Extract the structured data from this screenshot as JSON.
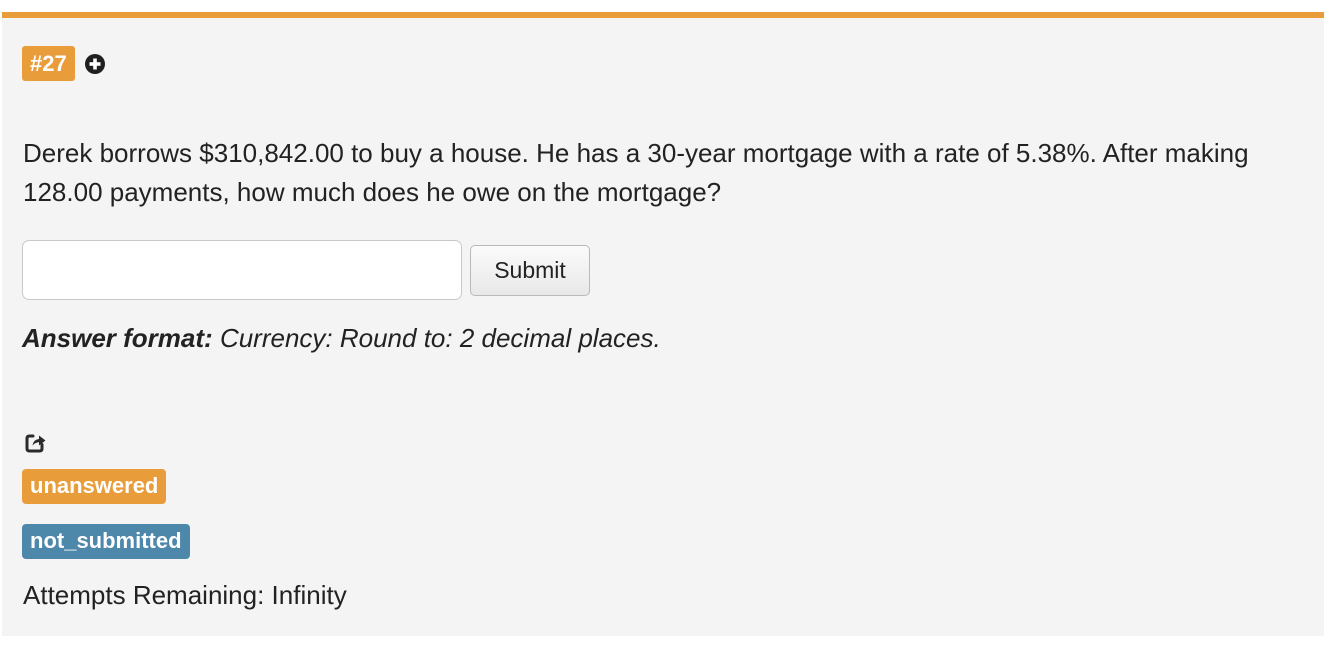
{
  "problem": {
    "number_label": "#27",
    "question_text": "Derek borrows $310,842.00 to buy a house. He has a 30-year mortgage with a rate of 5.38%. After making 128.00 payments, how much does he owe on the mortgage?",
    "answer_value": "",
    "submit_label": "Submit",
    "format_label": "Answer format:",
    "format_text": "Currency: Round to: 2 decimal places.",
    "status_badges": [
      "unanswered",
      "not_submitted"
    ],
    "attempts_text": "Attempts Remaining: Infinity"
  },
  "icons": {
    "add": "plus-circle-icon",
    "share": "share-icon"
  },
  "colors": {
    "accent": "#e99d3a",
    "info": "#4d87aa",
    "panel_bg": "#f4f4f4"
  }
}
